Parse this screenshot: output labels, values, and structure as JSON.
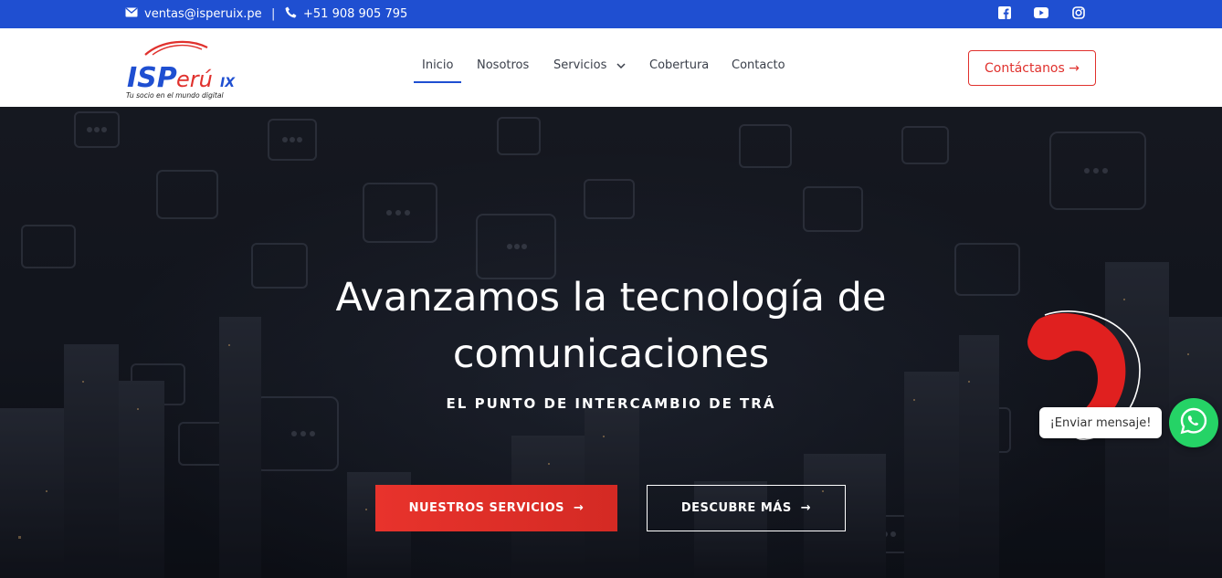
{
  "colors": {
    "top_bar": "#1f4fd1",
    "accent_red": "#e0312d",
    "nav_active_underline": "#1f4fd1",
    "whatsapp_green": "#25d366"
  },
  "topbar": {
    "email": "ventas@isperuix.pe",
    "separator": "|",
    "phone": "+51 908 905 795",
    "social_icons": [
      "facebook-icon",
      "youtube-icon",
      "instagram-icon"
    ]
  },
  "header": {
    "logo": {
      "brand_blue": "ISP",
      "brand_red": "erú",
      "brand_suffix": "IX",
      "tagline": "Tu socio en el mundo digital"
    },
    "nav": [
      {
        "label": "Inicio",
        "active": true
      },
      {
        "label": "Nosotros",
        "active": false
      },
      {
        "label": "Servicios",
        "active": false
      },
      {
        "label": "Cobertura",
        "active": false
      },
      {
        "label": "Contacto",
        "active": false
      }
    ],
    "contact_button": "Contáctanos →"
  },
  "hero": {
    "title_line1": "Avanzamos la tecnología de",
    "title_line2": "comunicaciones",
    "subtitle": "EL PUNTO DE INTERCAMBIO DE TRÁ",
    "primary_button": "NUESTROS SERVICIOS",
    "secondary_button": "DESCUBRE MÁS",
    "arrow": "→"
  },
  "whatsapp": {
    "label": "¡Enviar mensaje!"
  }
}
